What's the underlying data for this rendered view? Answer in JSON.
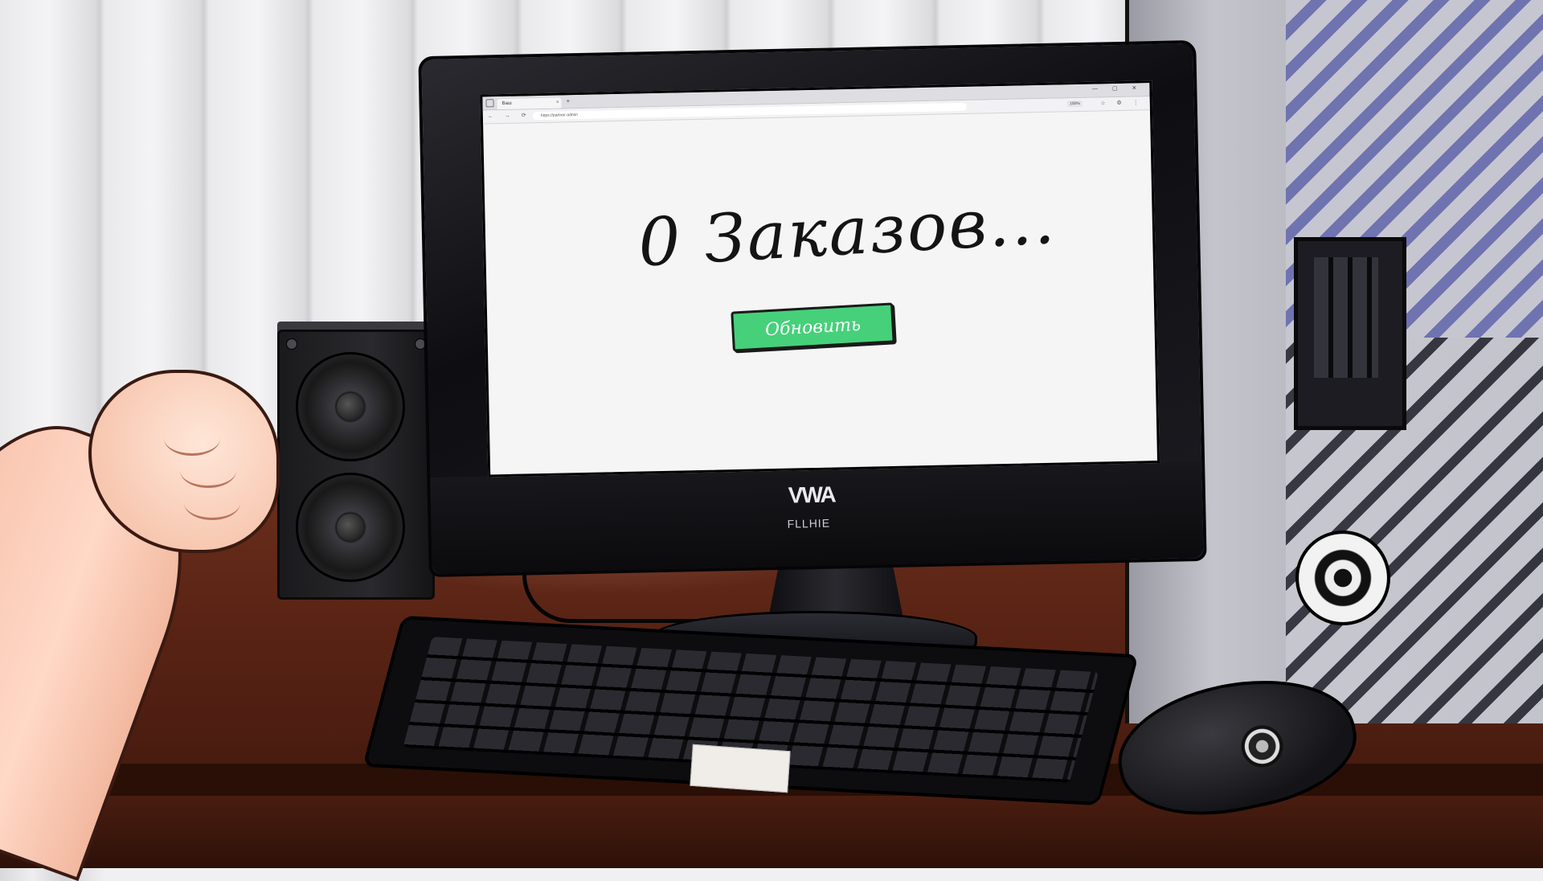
{
  "screen": {
    "browser": {
      "tab_title": "Ваш",
      "tab_close": "×",
      "new_tab": "+",
      "window_controls": "— ▢ ✕",
      "nav_buttons": "← → ⟳",
      "url": "https://partner-admin",
      "zoom_level": "100%",
      "toolbar_icons": "☆ ⚙ ⋮"
    },
    "message": "0 Заказов...",
    "refresh_button_label": "Обновить",
    "refresh_button_color": "#46d07a"
  },
  "monitor": {
    "brand": "VWA",
    "model": "FLLHIE"
  },
  "icons": {
    "power": "power-icon",
    "search": "address-bar",
    "close": "close-icon"
  }
}
